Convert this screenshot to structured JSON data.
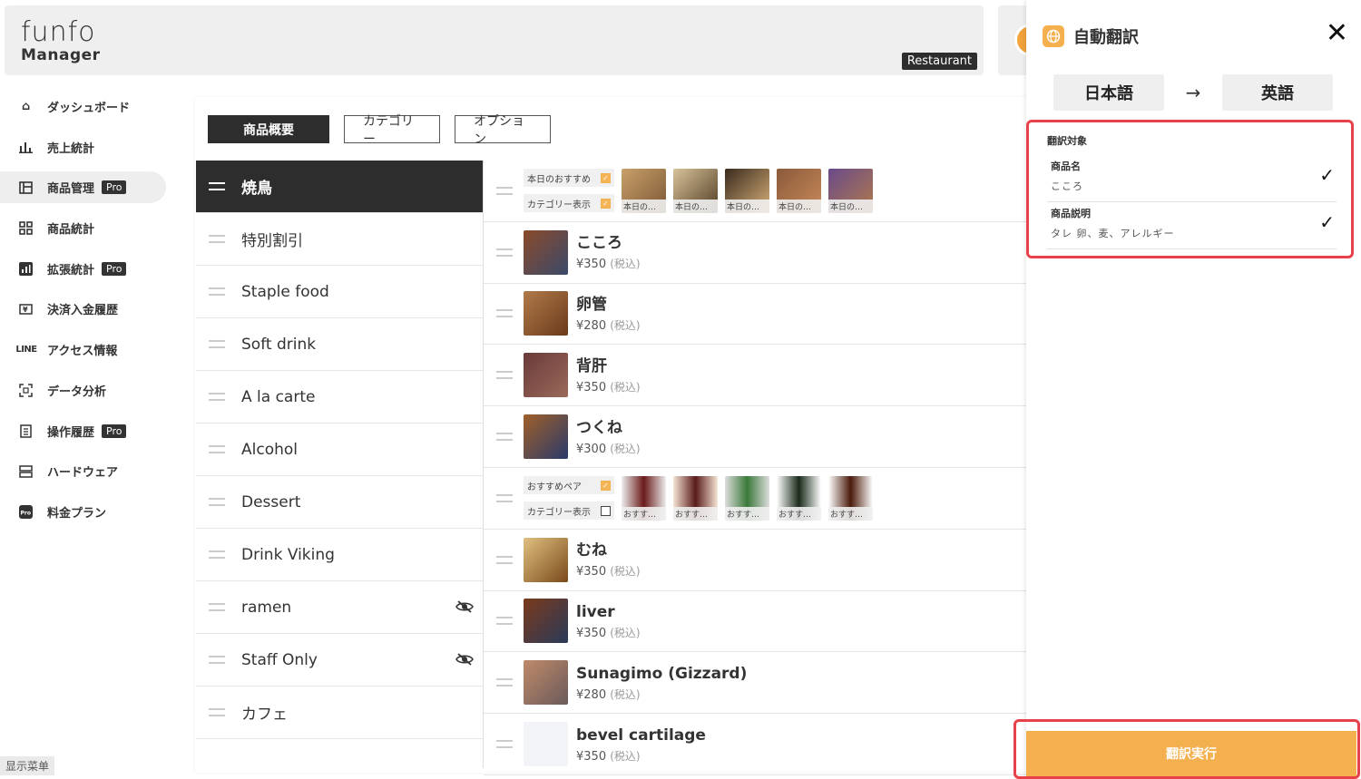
{
  "header": {
    "logo_top": "funfo",
    "logo_bottom": "Manager",
    "store_type": "Restaurant"
  },
  "sidebar": {
    "items": [
      {
        "label": "ダッシュボード",
        "icon": "home-icon",
        "pro": false
      },
      {
        "label": "売上統計",
        "icon": "bar-chart-icon",
        "pro": false
      },
      {
        "label": "商品管理",
        "icon": "layout-icon",
        "pro": true
      },
      {
        "label": "商品統計",
        "icon": "grid-icon",
        "pro": false
      },
      {
        "label": "拡張統計",
        "icon": "stats-icon",
        "pro": true
      },
      {
        "label": "決済入金履歴",
        "icon": "payment-icon",
        "pro": false
      },
      {
        "label": "アクセス情報",
        "icon": "line-icon",
        "pro": false
      },
      {
        "label": "データ分析",
        "icon": "scan-icon",
        "pro": false
      },
      {
        "label": "操作履歴",
        "icon": "list-icon",
        "pro": true
      },
      {
        "label": "ハードウェア",
        "icon": "hardware-icon",
        "pro": false
      },
      {
        "label": "料金プラン",
        "icon": "pro-plan-icon",
        "pro": false
      }
    ],
    "pro_label": "Pro",
    "line_label": "LINE",
    "bottom_label": "显示菜单"
  },
  "tabs": [
    "商品概要",
    "カテゴリー",
    "オプション"
  ],
  "categories": [
    "焼鳥",
    "特別割引",
    "Staple food",
    "Soft drink",
    "A la carte",
    "Alcohol",
    "Dessert",
    "Drink Viking",
    "ramen",
    "Staff Only",
    "カフェ"
  ],
  "option_groups": [
    {
      "row1": "本日のおすすめ",
      "row2": "カテゴリー表示",
      "caption": "本日の…"
    },
    {
      "row1": "おすすめペア",
      "row2": "カテゴリー表示",
      "caption": "おすす…"
    }
  ],
  "products": [
    {
      "name": "こころ",
      "price": "¥350",
      "tax": "(税込)"
    },
    {
      "name": "卵管",
      "price": "¥280",
      "tax": "(税込)"
    },
    {
      "name": "背肝",
      "price": "¥350",
      "tax": "(税込)"
    },
    {
      "name": "つくね",
      "price": "¥300",
      "tax": "(税込)"
    },
    {
      "name": "むね",
      "price": "¥350",
      "tax": "(税込)"
    },
    {
      "name": "liver",
      "price": "¥350",
      "tax": "(税込)"
    },
    {
      "name": "Sunagimo (Gizzard)",
      "price": "¥280",
      "tax": "(税込)"
    },
    {
      "name": "bevel cartilage",
      "price": "¥350",
      "tax": "(税込)"
    }
  ],
  "translate": {
    "title": "自動翻訳",
    "from": "日本語",
    "to": "英語",
    "arrow": "→",
    "target_title": "翻訳対象",
    "items": [
      {
        "label": "商品名",
        "value": "こころ"
      },
      {
        "label": "商品説明",
        "value": "タレ 卵、麦、アレルギー"
      }
    ],
    "execute": "翻訳実行"
  },
  "colors": {
    "accent": "#f4b04f",
    "highlight": "#e8414a",
    "dark": "#2d2d2d"
  }
}
